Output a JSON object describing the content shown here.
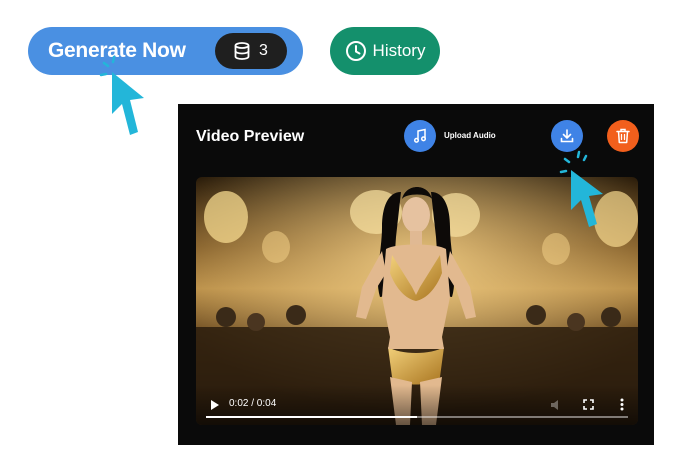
{
  "generate_button": {
    "label": "Generate Now",
    "credits": "3"
  },
  "history_button": {
    "label": "History"
  },
  "preview": {
    "title": "Video Preview",
    "upload_label": "Upload Audio"
  },
  "player": {
    "time": "0:02 / 0:04",
    "progress": 0.5
  },
  "colors": {
    "generate": "#4a90e2",
    "history": "#14906c",
    "upload": "#3f83e6",
    "delete": "#f25f1c",
    "cursor": "#23b6d9"
  }
}
